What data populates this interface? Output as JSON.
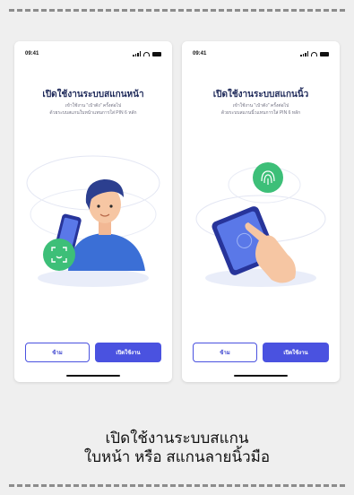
{
  "screens": [
    {
      "status_time": "09:41",
      "title": "เปิดใช้งานระบบสแกนหน้า",
      "desc_line1": "เข้าใช้งาน \"เป๋าตัง\" ครั้งต่อไป",
      "desc_line2": "ด้วยระบบสแกนใบหน้าแทนการใส่ PIN 6 หลัก",
      "skip_label": "ข้าม",
      "enable_label": "เปิดใช้งาน",
      "illustration": "face-scan-icon"
    },
    {
      "status_time": "09:41",
      "title": "เปิดใช้งานระบบสแกนนิ้ว",
      "desc_line1": "เข้าใช้งาน \"เป๋าตัง\" ครั้งต่อไป",
      "desc_line2": "ด้วยระบบสแกนนิ้วแทนการใส่ PIN 6 หลัก",
      "skip_label": "ข้าม",
      "enable_label": "เปิดใช้งาน",
      "illustration": "fingerprint-icon"
    }
  ],
  "caption": {
    "line1": "เปิดใช้งานระบบสแกน",
    "line2": "ใบหน้า หรือ สแกนลายนิ้วมือ"
  },
  "colors": {
    "primary": "#4a52e0",
    "title": "#1f2a5a",
    "green": "#3dbf78",
    "background": "#efefef"
  }
}
